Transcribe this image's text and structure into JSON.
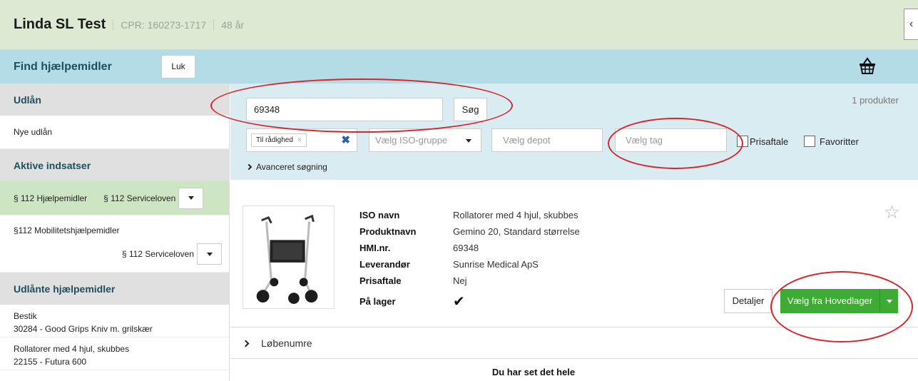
{
  "patient": {
    "name": "Linda SL Test",
    "cpr": "CPR: 160273-1717",
    "age": "48 år",
    "collapse_icon": "chevron-left-icon"
  },
  "header": {
    "title": "Find hjælpemidler",
    "close_label": "Luk",
    "basket_icon": "basket-icon"
  },
  "sidebar": {
    "loans_header": "Udlån",
    "new_loans": "Nye udlån",
    "active_header": "Aktive indsatser",
    "active_items": [
      {
        "label": "§ 112 Hjælpemidler",
        "law": "§ 112 Serviceloven"
      },
      {
        "label": "§112 Mobilitetshjælpemidler",
        "law": "§ 112 Serviceloven"
      }
    ],
    "lent_header": "Udlånte hjælpemidler",
    "lent_items": [
      {
        "category": "Bestik",
        "item": "30284 - Good Grips Kniv m. grilskær"
      },
      {
        "category": "Rollatorer med 4 hjul, skubbes",
        "item": "22155 - Futura 600"
      }
    ]
  },
  "filters": {
    "search_value": "69348",
    "search_button": "Søg",
    "result_count": "1 produkter",
    "availability_chip": "Til rådighed",
    "iso_placeholder": "Vælg ISO-gruppe",
    "depot_placeholder": "Vælg depot",
    "tag_placeholder": "Vælg tag",
    "price_agreement": "Prisaftale",
    "favorites": "Favoritter",
    "advanced": "Avanceret søgning"
  },
  "product": {
    "attributes": [
      {
        "label": "ISO navn",
        "value": "Rollatorer med 4 hjul, skubbes"
      },
      {
        "label": "Produktnavn",
        "value": "Gemino 20, Standard størrelse"
      },
      {
        "label": "HMI.nr.",
        "value": "69348"
      },
      {
        "label": "Leverandør",
        "value": "Sunrise Medical ApS"
      },
      {
        "label": "Prisaftale",
        "value": "Nej"
      },
      {
        "label": "På lager",
        "value": "✔"
      }
    ],
    "details_button": "Detaljer",
    "select_button": "Vælg fra Hovedlager",
    "favorite_icon": "star-icon"
  },
  "serials_label": "Løbenumre",
  "end_text": "Du har set det hele"
}
